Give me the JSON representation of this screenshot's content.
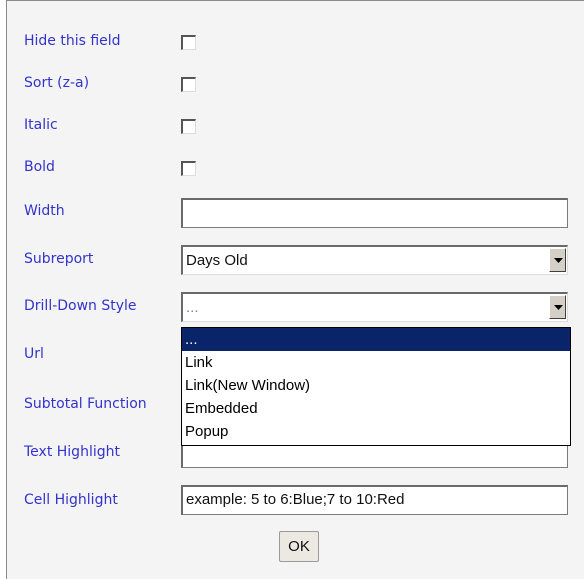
{
  "fields": {
    "hide_this_field": {
      "label": "Hide this field"
    },
    "sort_za": {
      "label": "Sort (z-a)"
    },
    "italic": {
      "label": "Italic"
    },
    "bold": {
      "label": "Bold"
    },
    "width": {
      "label": "Width",
      "value": ""
    },
    "subreport": {
      "label": "Subreport",
      "value": "Days Old"
    },
    "drill_down_style": {
      "label": "Drill-Down Style",
      "value": "...",
      "options": [
        "...",
        "Link",
        "Link(New Window)",
        "Embedded",
        "Popup"
      ]
    },
    "url": {
      "label": "Url"
    },
    "subtotal_function": {
      "label": "Subtotal Function"
    },
    "text_highlight": {
      "label": "Text Highlight"
    },
    "cell_highlight": {
      "label": "Cell Highlight",
      "value": "example: 5 to 6:Blue;7 to 10:Red"
    }
  },
  "ok_label": "OK",
  "colors": {
    "label": "#3333cc",
    "selected_option_bg": "#0a246a",
    "panel_bg": "#f4f4f4"
  },
  "icons": {
    "dropdown_arrow": "triangle-down-icon"
  }
}
